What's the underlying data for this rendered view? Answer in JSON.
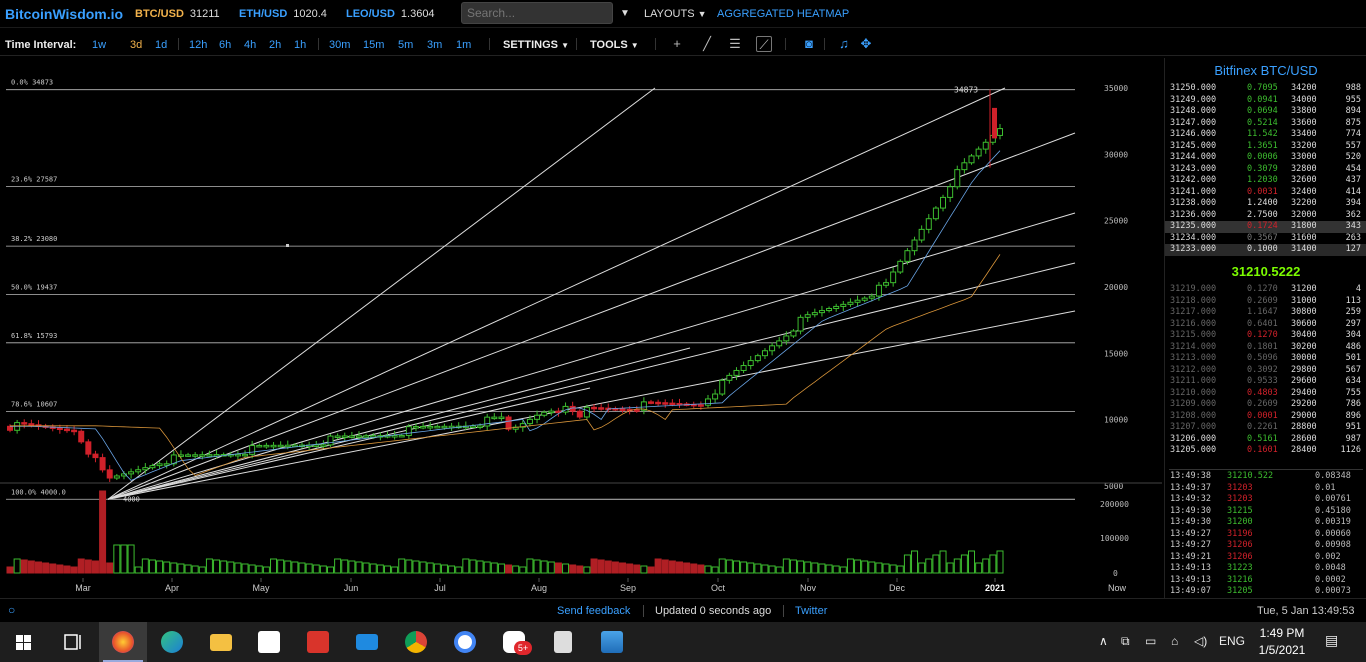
{
  "topbar": {
    "logo": "BitcoinWisdom.io",
    "tickers": [
      {
        "sym": "BTC/USD",
        "val": "31211"
      },
      {
        "sym": "ETH/USD",
        "val": "1020.4"
      },
      {
        "sym": "LEO/USD",
        "val": "1.3604"
      }
    ],
    "search_placeholder": "Search...",
    "layouts": "LAYOUTS",
    "heatmap": "AGGREGATED HEATMAP"
  },
  "toolbar": {
    "interval_label": "Time Interval:",
    "intervals": [
      "1w",
      "3d",
      "1d",
      "12h",
      "6h",
      "4h",
      "2h",
      "1h",
      "30m",
      "15m",
      "5m",
      "3m",
      "1m"
    ],
    "active_interval": "3d",
    "settings": "SETTINGS",
    "tools": "TOOLS"
  },
  "chart_data": {
    "type": "candlestick",
    "fib_levels": [
      {
        "label": "0.0%",
        "value": "34873"
      },
      {
        "label": "23.6%",
        "value": "27587"
      },
      {
        "label": "38.2%",
        "value": "23080"
      },
      {
        "label": "50.0%",
        "value": "19437"
      },
      {
        "label": "61.8%",
        "value": "15793"
      },
      {
        "label": "78.6%",
        "value": "10607"
      },
      {
        "label": "100.0%",
        "value": "4000.0"
      }
    ],
    "high_label": "34873",
    "low_label": "4000",
    "price_ticks": [
      "35000",
      "30000",
      "25000",
      "20000",
      "15000",
      "10000",
      "5000"
    ],
    "volume_ticks": [
      "200000",
      "100000",
      "0"
    ],
    "x_ticks": [
      "Mar",
      "Apr",
      "May",
      "Jun",
      "Jul",
      "Aug",
      "Sep",
      "Oct",
      "Nov",
      "Dec",
      "2021",
      "Now"
    ]
  },
  "book": {
    "title": "Bitfinex BTC/USD",
    "bids": [
      [
        "31250.000",
        "0.7095",
        "34200",
        "988"
      ],
      [
        "31249.000",
        "0.0941",
        "34000",
        "955"
      ],
      [
        "31248.000",
        "0.0694",
        "33800",
        "894"
      ],
      [
        "31247.000",
        "0.5214",
        "33600",
        "875"
      ],
      [
        "31246.000",
        "11.542",
        "33400",
        "774"
      ],
      [
        "31245.000",
        "1.3651",
        "33200",
        "557"
      ],
      [
        "31244.000",
        "0.0006",
        "33000",
        "520"
      ],
      [
        "31243.000",
        "0.3079",
        "32800",
        "454"
      ],
      [
        "31242.000",
        "1.2030",
        "32600",
        "437"
      ],
      [
        "31241.000",
        "0.0031",
        "32400",
        "414"
      ],
      [
        "31238.000",
        "1.2400",
        "32200",
        "394"
      ],
      [
        "31236.000",
        "2.7500",
        "32000",
        "362"
      ],
      [
        "31235.000",
        "0.1724",
        "31800",
        "343"
      ],
      [
        "31234.000",
        "0.3567",
        "31600",
        "263"
      ],
      [
        "31233.000",
        "0.1000",
        "31400",
        "127"
      ]
    ],
    "last_price": "31210.5222",
    "asks": [
      [
        "31219.000",
        "0.1270",
        "31200",
        "4"
      ],
      [
        "31218.000",
        "0.2609",
        "31000",
        "113"
      ],
      [
        "31217.000",
        "1.1647",
        "30800",
        "259"
      ],
      [
        "31216.000",
        "0.6401",
        "30600",
        "297"
      ],
      [
        "31215.000",
        "0.1270",
        "30400",
        "304"
      ],
      [
        "31214.000",
        "0.1801",
        "30200",
        "486"
      ],
      [
        "31213.000",
        "0.5096",
        "30000",
        "501"
      ],
      [
        "31212.000",
        "0.3092",
        "29800",
        "567"
      ],
      [
        "31211.000",
        "0.9533",
        "29600",
        "634"
      ],
      [
        "31210.000",
        "0.4803",
        "29400",
        "755"
      ],
      [
        "31209.000",
        "0.2609",
        "29200",
        "786"
      ],
      [
        "31208.000",
        "0.0001",
        "29000",
        "896"
      ],
      [
        "31207.000",
        "0.2261",
        "28800",
        "951"
      ],
      [
        "31206.000",
        "0.5161",
        "28600",
        "987"
      ],
      [
        "31205.000",
        "0.1601",
        "28400",
        "1126"
      ]
    ],
    "trades": [
      [
        "13:49:38",
        "31210.522",
        "0.08348"
      ],
      [
        "13:49:37",
        "31203",
        "0.01"
      ],
      [
        "13:49:32",
        "31203",
        "0.00761"
      ],
      [
        "13:49:30",
        "31215",
        "0.45180"
      ],
      [
        "13:49:30",
        "31200",
        "0.00319"
      ],
      [
        "13:49:27",
        "31196",
        "0.00060"
      ],
      [
        "13:49:27",
        "31206",
        "0.00908"
      ],
      [
        "13:49:21",
        "31206",
        "0.002"
      ],
      [
        "13:49:13",
        "31223",
        "0.0048"
      ],
      [
        "13:49:13",
        "31216",
        "0.0002"
      ],
      [
        "13:49:07",
        "31205",
        "0.00073"
      ]
    ]
  },
  "footer": {
    "feedback": "Send feedback",
    "updated": "Updated 0 seconds ago",
    "twitter": "Twitter",
    "datetime": "Tue, 5 Jan 13:49:53"
  },
  "taskbar": {
    "lang": "ENG",
    "time": "1:49 PM",
    "date": "1/5/2021",
    "badge": "5+"
  },
  "colors": {
    "accent": "#3aa0ff",
    "up": "#3dbd2f",
    "down": "#d0212a",
    "gold": "#f2b24b"
  }
}
